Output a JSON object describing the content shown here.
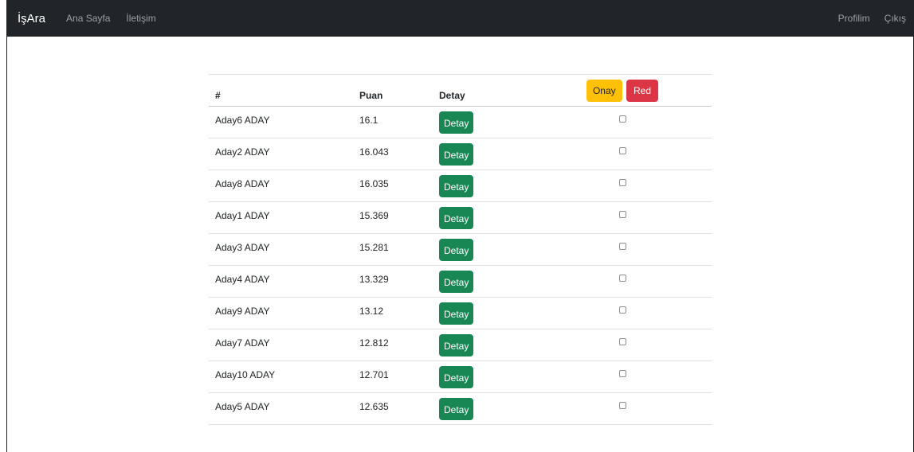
{
  "navbar": {
    "brand": "İşAra",
    "links": [
      "Ana Sayfa",
      "İletişim"
    ],
    "right_links": [
      "Profilim",
      "Çıkış"
    ]
  },
  "table": {
    "headers": {
      "number": "#",
      "score": "Puan",
      "detail": "Detay"
    },
    "approve_label": "Onay",
    "reject_label": "Red",
    "detail_button_label": "Detay",
    "rows": [
      {
        "name": "Aday6 ADAY",
        "score": "16.1"
      },
      {
        "name": "Aday2 ADAY",
        "score": "16.043"
      },
      {
        "name": "Aday8 ADAY",
        "score": "16.035"
      },
      {
        "name": "Aday1 ADAY",
        "score": "15.369"
      },
      {
        "name": "Aday3 ADAY",
        "score": "15.281"
      },
      {
        "name": "Aday4 ADAY",
        "score": "13.329"
      },
      {
        "name": "Aday9 ADAY",
        "score": "13.12"
      },
      {
        "name": "Aday7 ADAY",
        "score": "12.812"
      },
      {
        "name": "Aday10 ADAY",
        "score": "12.701"
      },
      {
        "name": "Aday5 ADAY",
        "score": "12.635"
      }
    ]
  },
  "colors": {
    "navbar_bg": "#212529",
    "detail_button": "#198754",
    "approve_button": "#ffc107",
    "reject_button": "#dc3545"
  },
  "icons": {
    "row_select": "checkbox-icon"
  }
}
